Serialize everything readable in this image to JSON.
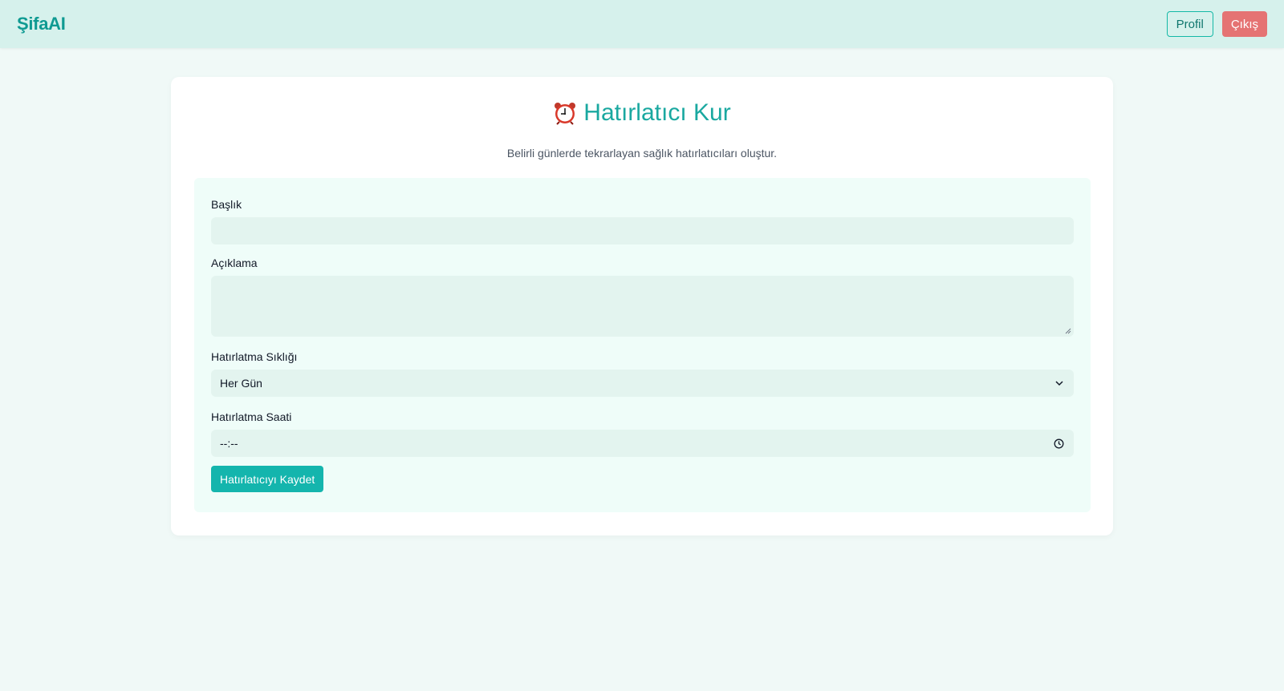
{
  "navbar": {
    "brand": "ŞifaAI",
    "profile_label": "Profil",
    "logout_label": "Çıkış"
  },
  "page": {
    "title": "Hatırlatıcı Kur",
    "subtitle": "Belirli günlerde tekrarlayan sağlık hatırlatıcıları oluştur.",
    "title_icon": "alarm-clock-icon"
  },
  "form": {
    "title_label": "Başlık",
    "title_value": "",
    "description_label": "Açıklama",
    "description_value": "",
    "frequency_label": "Hatırlatma Sıklığı",
    "frequency_value": "Her Gün",
    "time_label": "Hatırlatma Saati",
    "time_value": "--:--",
    "save_label": "Hatırlatıcıyı Kaydet"
  },
  "colors": {
    "accent": "#14b5ad",
    "navbar_bg": "#d6f1ec",
    "logout": "#e57373",
    "page_bg": "#f0f9f7"
  }
}
